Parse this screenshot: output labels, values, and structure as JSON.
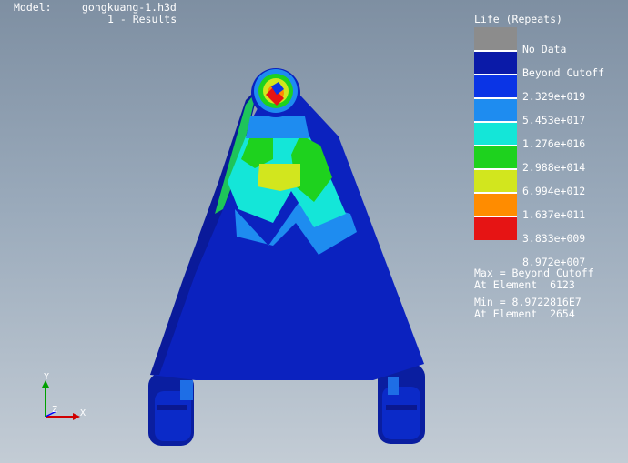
{
  "header": {
    "model_label": "Model:",
    "model_file": "gongkuang-1.h3d",
    "subcase": "1 - Results"
  },
  "legend": {
    "title": "Life (Repeats)",
    "entries": [
      {
        "label": "No Data",
        "color": "#8c8c8c"
      },
      {
        "label": "Beyond Cutoff",
        "color": "#0a1aa8"
      },
      {
        "label": "2.329e+019",
        "color": "#0a34e6"
      },
      {
        "label": "5.453e+017",
        "color": "#1e8cf0"
      },
      {
        "label": "1.276e+016",
        "color": "#14e6d8"
      },
      {
        "label": "2.988e+014",
        "color": "#1ed21e"
      },
      {
        "label": "6.994e+012",
        "color": "#d2e61e"
      },
      {
        "label": "1.637e+011",
        "color": "#ff8c00"
      },
      {
        "label": "3.833e+009",
        "color": "#e61414"
      },
      {
        "label": "8.972e+007",
        "color": ""
      }
    ]
  },
  "summary": {
    "max_line": "Max = Beyond Cutoff",
    "max_element": "At Element  6123",
    "min_line": "Min = 8.9722816E7",
    "min_element": "At Element  2654"
  },
  "triad": {
    "y_label": "Y",
    "z_label": "Z",
    "x_label": "X",
    "y_color": "#00a000",
    "x_color": "#d00000",
    "z_color": "#0000ff"
  }
}
